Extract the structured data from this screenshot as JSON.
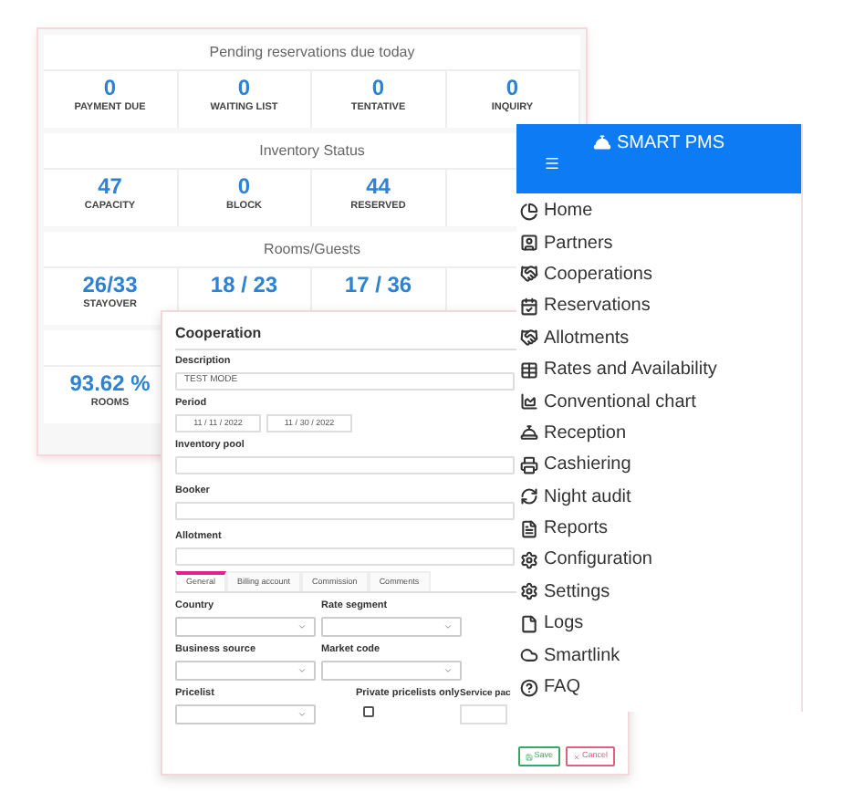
{
  "dashboard": {
    "sections": [
      {
        "title": "Pending reservations due today",
        "stats": [
          {
            "value": "0",
            "label": "PAYMENT DUE"
          },
          {
            "value": "0",
            "label": "WAITING LIST"
          },
          {
            "value": "0",
            "label": "TENTATIVE"
          },
          {
            "value": "0",
            "label": "INQUIRY"
          }
        ]
      },
      {
        "title": "Inventory Status",
        "stats": [
          {
            "value": "47",
            "label": "CAPACITY"
          },
          {
            "value": "0",
            "label": "BLOCK"
          },
          {
            "value": "44",
            "label": "RESERVED"
          }
        ]
      },
      {
        "title": "Rooms/Guests",
        "stats": [
          {
            "value": "26/33",
            "label": "STAYOVER"
          },
          {
            "value": "18 / 23"
          },
          {
            "value": "17 / 36"
          }
        ]
      },
      {
        "stats": [
          {
            "value": "93.62 %",
            "label": "ROOMS"
          }
        ]
      }
    ]
  },
  "modal": {
    "title": "Cooperation",
    "description": {
      "label": "Description",
      "value": "TEST MODE"
    },
    "period": {
      "label": "Period",
      "from": "11 / 11 / 2022",
      "to": "11 / 30 / 2022"
    },
    "inventory_pool": {
      "label": "Inventory pool"
    },
    "booker": {
      "label": "Booker"
    },
    "allotment": {
      "label": "Allotment"
    },
    "tabs": [
      {
        "label": "General",
        "selected": true
      },
      {
        "label": "Billing account",
        "selected": false
      },
      {
        "label": "Commission",
        "selected": false
      },
      {
        "label": "Comments",
        "selected": false
      }
    ],
    "country": {
      "label": "Country"
    },
    "rate_segment": {
      "label": "Rate segment"
    },
    "business_source": {
      "label": "Business source"
    },
    "market_code": {
      "label": "Market code"
    },
    "pricelist": {
      "label": "Pricelist"
    },
    "private_pricelists_only": {
      "label": "Private pricelists only",
      "checked": false
    },
    "service_package": {
      "label": "Service pac"
    },
    "buttons": [
      {
        "kind": "save",
        "label": "Save"
      },
      {
        "kind": "cancel",
        "label": "Cancel"
      }
    ]
  },
  "sidebar": {
    "title": "SMART PMS",
    "items": [
      {
        "label": "Home"
      },
      {
        "label": "Partners"
      },
      {
        "label": "Cooperations"
      },
      {
        "label": "Reservations"
      },
      {
        "label": "Allotments"
      },
      {
        "label": "Rates and Availability"
      },
      {
        "label": "Conventional chart"
      },
      {
        "label": "Reception"
      },
      {
        "label": "Cashiering"
      },
      {
        "label": "Night audit"
      },
      {
        "label": "Reports"
      },
      {
        "label": "Configuration"
      },
      {
        "label": "Settings"
      },
      {
        "label": "Logs"
      },
      {
        "label": "Smartlink"
      },
      {
        "label": "FAQ"
      }
    ]
  }
}
